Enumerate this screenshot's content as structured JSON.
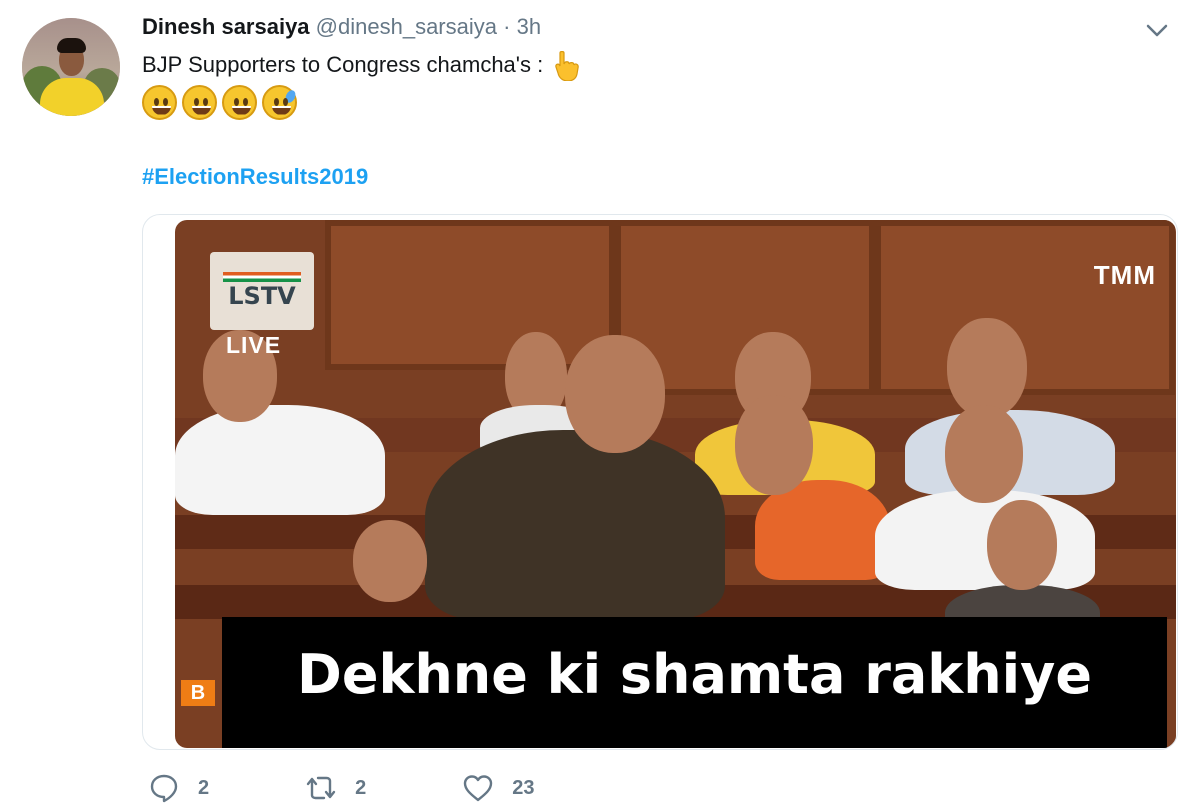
{
  "tweet": {
    "author": {
      "name": "Dinesh sarsaiya",
      "handle": "@dinesh_sarsaiya",
      "separator": "·",
      "time": "3h"
    },
    "text": "BJP Supporters to Congress chamcha's :",
    "emojis": [
      "grinning-face",
      "grinning-face",
      "grinning-face",
      "grinning-face-with-sweat"
    ],
    "hashtag": "#ElectionResults2019",
    "media": {
      "channel_logo": "LSTV",
      "live_label": "LIVE",
      "watermark": "TMM",
      "corner_badge": "B",
      "caption": "Dekhne ki shamta rakhiye"
    },
    "actions": {
      "reply_count": "2",
      "retweet_count": "2",
      "like_count": "23"
    }
  },
  "icons": {
    "menu": "chevron-down-icon",
    "pointing": "backhand-index-pointing-down-icon",
    "reply": "reply-icon",
    "retweet": "retweet-icon",
    "like": "heart-icon"
  },
  "colors": {
    "name": "#14171a",
    "secondary": "#657786",
    "hashtag": "#1da1f2"
  }
}
